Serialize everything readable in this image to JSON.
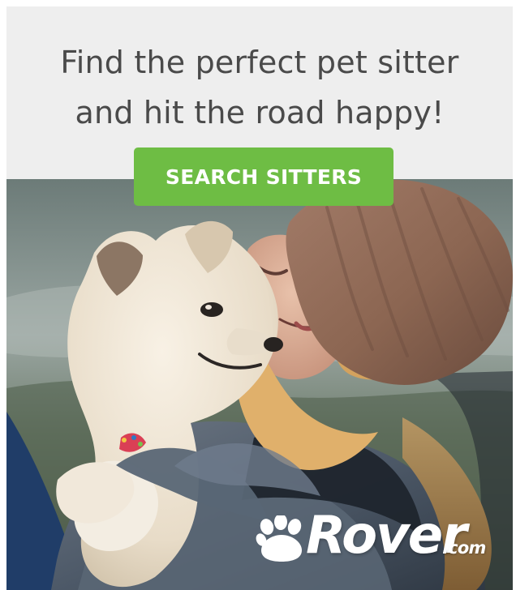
{
  "ad": {
    "headline_line_1": "Find the perfect pet sitter",
    "headline_line_2": "and hit the road happy!",
    "cta_label": "SEARCH SITTERS"
  },
  "brand": {
    "name": "Rover",
    "domain": ".com",
    "accent_color": "#6ebd44"
  },
  "icons": {
    "logo_icon": "paw-icon"
  },
  "photo": {
    "alt": "Woman in a brown knit beanie kissing a white fluffy dog outdoors"
  }
}
